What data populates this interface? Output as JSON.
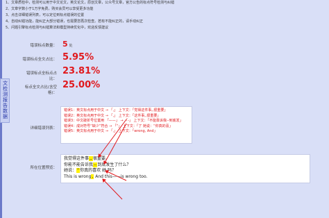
{
  "notes": [
    "1、文章质检中，检测可以用于中文论文，英文论文，原创文章，公众号文章，官方公告的标点符号检测与纠错",
    "2、文章字数小于1万字免费，购买会员可以享受更多功能",
    "3、点击详细错误列表，可以定位到标点错误的位置",
    "4、自动纠错功能，能纠正大部分错误，也需要您再次检查。若有不能纠正的，请手动纠正",
    "5、问题引擎标点检测与纠错算法和模型持续优化中，欢迎反馈建议"
  ],
  "side_tab": [
    "文",
    "检",
    "测",
    "报",
    "告",
    "数",
    "据"
  ],
  "stats": [
    {
      "label": "错误标点数量：",
      "value": "5",
      "unit": "处"
    },
    {
      "label": "错误标点全文占比：",
      "value": "5.95%"
    },
    {
      "label": "错误标点全标点占比：",
      "value": "23.81%"
    },
    {
      "label": "标点全文占比(含空格)：",
      "value": "25.00%"
    }
  ],
  "error_list_label": "详细错误列表：",
  "error_list": [
    "错误1：英文标点用于中文 → 「,」 上下文：「觉得这件事,,很重要」",
    "错误2：英文标点用于中文 → 「,」 上下文：「这件事,,很重要」",
    "错误3：中文破折号位置用 「——」 → 「-」 上下文：「不能靠诉我--到底发」",
    "错误4：成对符号“缺少”符合 → 「“」 上下文：「了 她说：“你真的喜」",
    "错误5：英文标点用于中文 → 「,」 上下文：「wrong, And」"
  ],
  "preview_label": "所在位置预览：",
  "preview_lines": [
    {
      "before": "我觉得这件事",
      "hl": ",,",
      "after": "很重要。"
    },
    {
      "before": "你能不能告诉我",
      "hl": "--",
      "after": "到底发生了什么？"
    },
    {
      "before": "她说：",
      "hl": "“",
      "after": "你真的喜欢 她 吗？"
    },
    {
      "before": "This is wrong",
      "hl": ",",
      "after": " And this——is wrong too."
    }
  ],
  "colors": {
    "accent_red": "#e0191d",
    "background": "#d9dff7",
    "highlight": "#fff000"
  }
}
